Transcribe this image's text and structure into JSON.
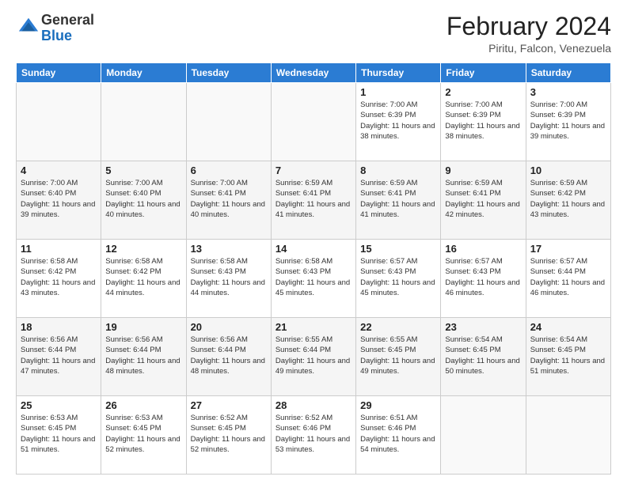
{
  "logo": {
    "general": "General",
    "blue": "Blue"
  },
  "header": {
    "title": "February 2024",
    "subtitle": "Piritu, Falcon, Venezuela"
  },
  "days_of_week": [
    "Sunday",
    "Monday",
    "Tuesday",
    "Wednesday",
    "Thursday",
    "Friday",
    "Saturday"
  ],
  "weeks": [
    [
      {
        "day": "",
        "info": ""
      },
      {
        "day": "",
        "info": ""
      },
      {
        "day": "",
        "info": ""
      },
      {
        "day": "",
        "info": ""
      },
      {
        "day": "1",
        "info": "Sunrise: 7:00 AM\nSunset: 6:39 PM\nDaylight: 11 hours and 38 minutes."
      },
      {
        "day": "2",
        "info": "Sunrise: 7:00 AM\nSunset: 6:39 PM\nDaylight: 11 hours and 38 minutes."
      },
      {
        "day": "3",
        "info": "Sunrise: 7:00 AM\nSunset: 6:39 PM\nDaylight: 11 hours and 39 minutes."
      }
    ],
    [
      {
        "day": "4",
        "info": "Sunrise: 7:00 AM\nSunset: 6:40 PM\nDaylight: 11 hours and 39 minutes."
      },
      {
        "day": "5",
        "info": "Sunrise: 7:00 AM\nSunset: 6:40 PM\nDaylight: 11 hours and 40 minutes."
      },
      {
        "day": "6",
        "info": "Sunrise: 7:00 AM\nSunset: 6:41 PM\nDaylight: 11 hours and 40 minutes."
      },
      {
        "day": "7",
        "info": "Sunrise: 6:59 AM\nSunset: 6:41 PM\nDaylight: 11 hours and 41 minutes."
      },
      {
        "day": "8",
        "info": "Sunrise: 6:59 AM\nSunset: 6:41 PM\nDaylight: 11 hours and 41 minutes."
      },
      {
        "day": "9",
        "info": "Sunrise: 6:59 AM\nSunset: 6:41 PM\nDaylight: 11 hours and 42 minutes."
      },
      {
        "day": "10",
        "info": "Sunrise: 6:59 AM\nSunset: 6:42 PM\nDaylight: 11 hours and 43 minutes."
      }
    ],
    [
      {
        "day": "11",
        "info": "Sunrise: 6:58 AM\nSunset: 6:42 PM\nDaylight: 11 hours and 43 minutes."
      },
      {
        "day": "12",
        "info": "Sunrise: 6:58 AM\nSunset: 6:42 PM\nDaylight: 11 hours and 44 minutes."
      },
      {
        "day": "13",
        "info": "Sunrise: 6:58 AM\nSunset: 6:43 PM\nDaylight: 11 hours and 44 minutes."
      },
      {
        "day": "14",
        "info": "Sunrise: 6:58 AM\nSunset: 6:43 PM\nDaylight: 11 hours and 45 minutes."
      },
      {
        "day": "15",
        "info": "Sunrise: 6:57 AM\nSunset: 6:43 PM\nDaylight: 11 hours and 45 minutes."
      },
      {
        "day": "16",
        "info": "Sunrise: 6:57 AM\nSunset: 6:43 PM\nDaylight: 11 hours and 46 minutes."
      },
      {
        "day": "17",
        "info": "Sunrise: 6:57 AM\nSunset: 6:44 PM\nDaylight: 11 hours and 46 minutes."
      }
    ],
    [
      {
        "day": "18",
        "info": "Sunrise: 6:56 AM\nSunset: 6:44 PM\nDaylight: 11 hours and 47 minutes."
      },
      {
        "day": "19",
        "info": "Sunrise: 6:56 AM\nSunset: 6:44 PM\nDaylight: 11 hours and 48 minutes."
      },
      {
        "day": "20",
        "info": "Sunrise: 6:56 AM\nSunset: 6:44 PM\nDaylight: 11 hours and 48 minutes."
      },
      {
        "day": "21",
        "info": "Sunrise: 6:55 AM\nSunset: 6:44 PM\nDaylight: 11 hours and 49 minutes."
      },
      {
        "day": "22",
        "info": "Sunrise: 6:55 AM\nSunset: 6:45 PM\nDaylight: 11 hours and 49 minutes."
      },
      {
        "day": "23",
        "info": "Sunrise: 6:54 AM\nSunset: 6:45 PM\nDaylight: 11 hours and 50 minutes."
      },
      {
        "day": "24",
        "info": "Sunrise: 6:54 AM\nSunset: 6:45 PM\nDaylight: 11 hours and 51 minutes."
      }
    ],
    [
      {
        "day": "25",
        "info": "Sunrise: 6:53 AM\nSunset: 6:45 PM\nDaylight: 11 hours and 51 minutes."
      },
      {
        "day": "26",
        "info": "Sunrise: 6:53 AM\nSunset: 6:45 PM\nDaylight: 11 hours and 52 minutes."
      },
      {
        "day": "27",
        "info": "Sunrise: 6:52 AM\nSunset: 6:45 PM\nDaylight: 11 hours and 52 minutes."
      },
      {
        "day": "28",
        "info": "Sunrise: 6:52 AM\nSunset: 6:46 PM\nDaylight: 11 hours and 53 minutes."
      },
      {
        "day": "29",
        "info": "Sunrise: 6:51 AM\nSunset: 6:46 PM\nDaylight: 11 hours and 54 minutes."
      },
      {
        "day": "",
        "info": ""
      },
      {
        "day": "",
        "info": ""
      }
    ]
  ]
}
